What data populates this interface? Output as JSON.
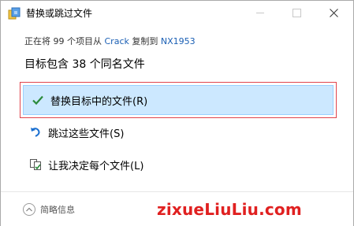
{
  "window": {
    "title": "替换或跳过文件"
  },
  "info": {
    "prefix": "正在将 99 个项目从",
    "source": "Crack",
    "middle": "复制到",
    "destination": "NX1953"
  },
  "heading": "目标包含 38 个同名文件",
  "options": [
    {
      "label": "替换目标中的文件(R)",
      "icon": "checkmark-icon"
    },
    {
      "label": "跳过这些文件(S)",
      "icon": "skip-arrow-icon"
    },
    {
      "label": "让我决定每个文件(L)",
      "icon": "compare-files-icon"
    }
  ],
  "footer": {
    "details_label": "简略信息"
  },
  "watermark": "zixueLiuLiu.com",
  "colors": {
    "accent_blue": "#1a5fb4",
    "selection_bg": "#cce8ff",
    "selection_border": "#99d1ff",
    "highlight_red": "#e0444d",
    "watermark_red": "#e02020",
    "check_green": "#2a8a3a"
  }
}
